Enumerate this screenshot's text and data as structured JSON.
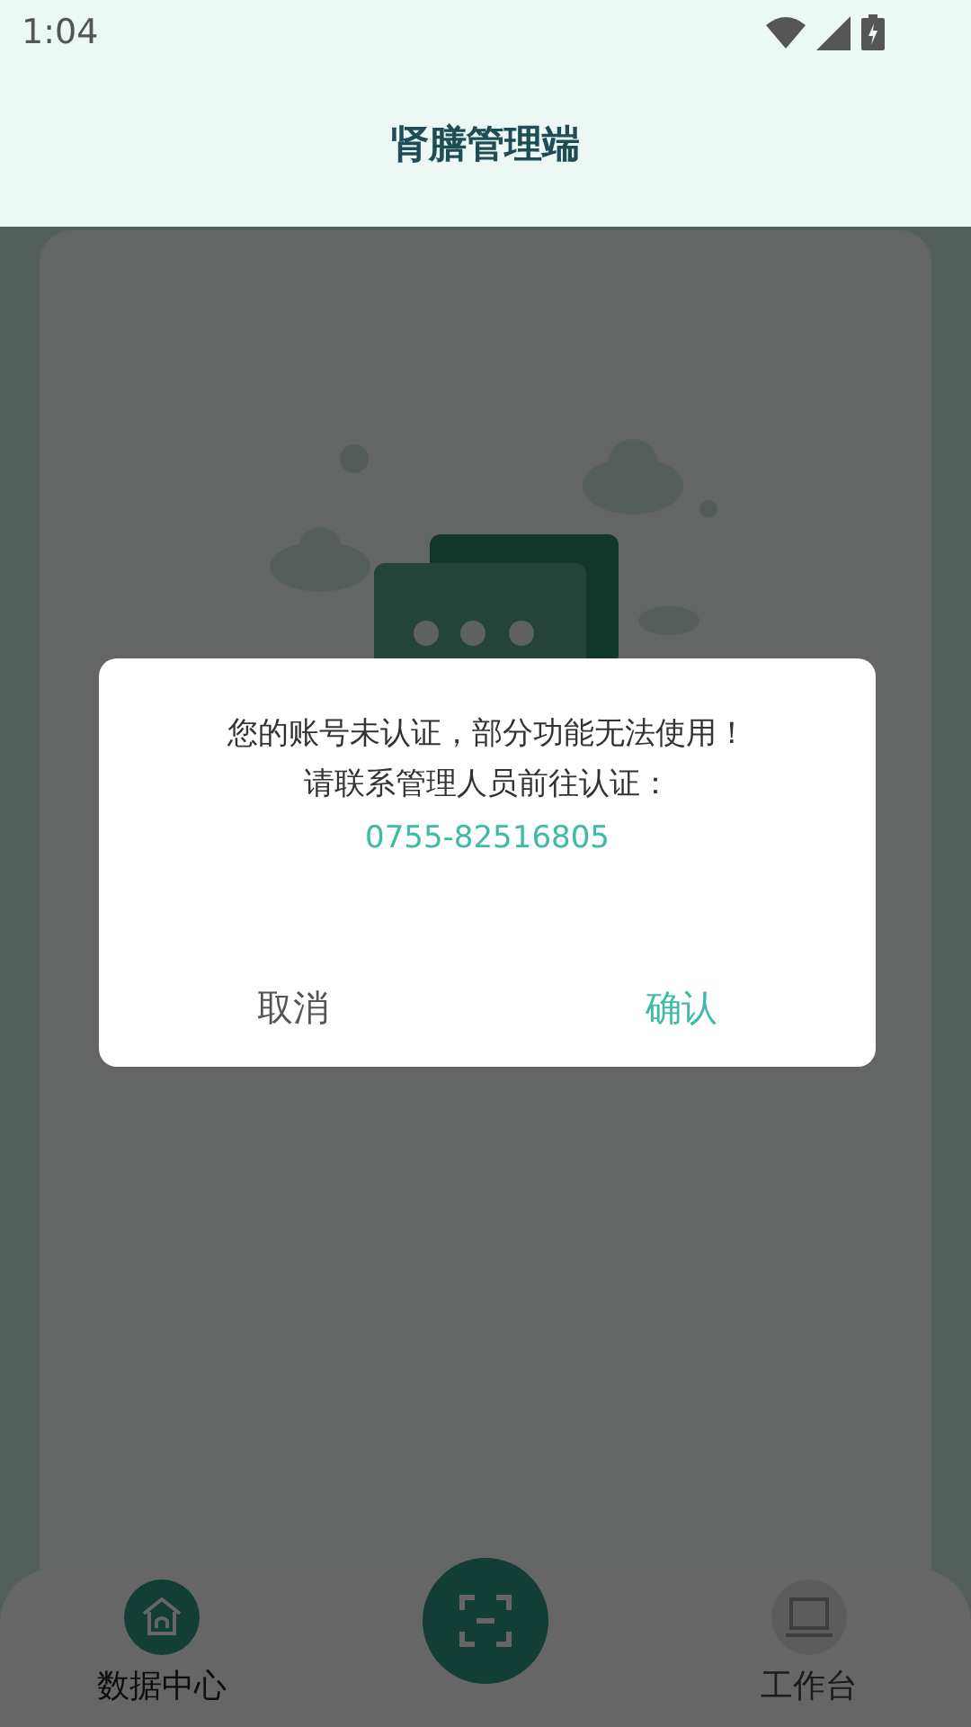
{
  "status_bar": {
    "time": "1:04"
  },
  "header": {
    "title": "肾膳管理端"
  },
  "dialog": {
    "lines": [
      "您的账号未认证，部分功能无法使用！",
      "请联系管理人员前往认证："
    ],
    "phone": "0755-82516805",
    "buttons": [
      {
        "label": "取消",
        "kind": "cancel"
      },
      {
        "label": "确认",
        "kind": "confirm"
      }
    ]
  },
  "bottom_nav": [
    {
      "kind": "tab",
      "label": "数据中心",
      "selected": true
    },
    {
      "kind": "scan"
    },
    {
      "kind": "tab",
      "label": "工作台",
      "selected": false
    }
  ]
}
